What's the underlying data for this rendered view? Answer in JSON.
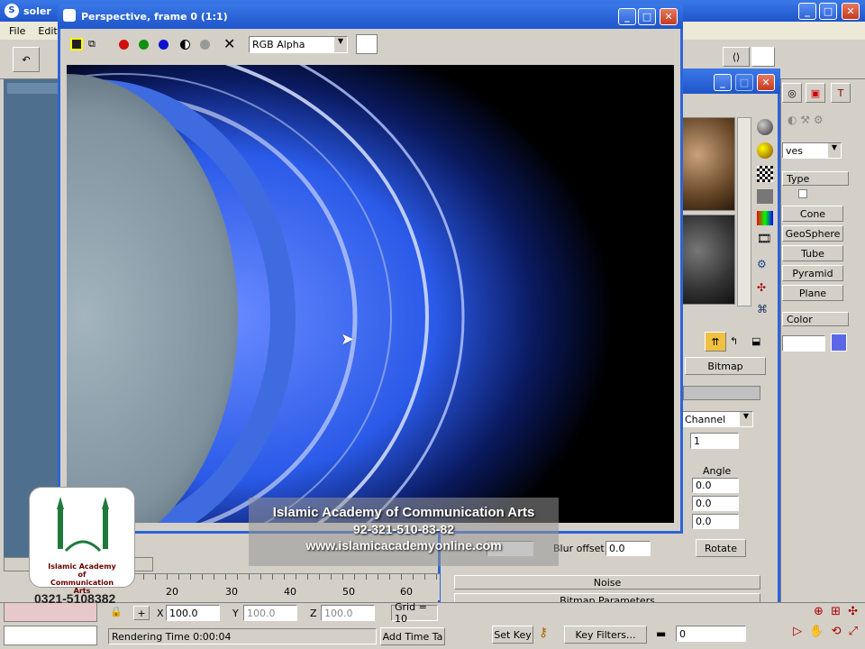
{
  "app": {
    "title": "soler",
    "menu": [
      "File",
      "Edit"
    ]
  },
  "render_window": {
    "title": "Perspective, frame 0 (1:1)",
    "channel_select": "RGB Alpha"
  },
  "mat_panel": {
    "buttons": [
      "Cone",
      "GeoSphere",
      "Tube",
      "Pyramid",
      "Plane"
    ],
    "color_label": "Color",
    "type_label": "Type",
    "dropdown": "ves"
  },
  "map_panel": {
    "bitmap_btn": "Bitmap",
    "channel": "Channel",
    "channel_value": "1",
    "angle_label": "Angle",
    "u": "0.0",
    "v": "0.0",
    "w": "0.0",
    "blur_offset_label": "Blur offset:",
    "blur_offset": "0.0",
    "rotate_btn": "Rotate",
    "noise": "Noise",
    "bitmap_params": "Bitmap Parameters"
  },
  "timeline": {
    "ticks": [
      "20",
      "30",
      "40",
      "50",
      "60"
    ]
  },
  "status": {
    "x_label": "X",
    "x": "100.0",
    "y_label": "Y",
    "y": "100.0",
    "z_label": "Z",
    "z": "100.0",
    "grid": "Grid = 10",
    "rendering": "Rendering Time  0:00:04",
    "add_time_tag": "Add Time Ta",
    "set_key": "Set Key",
    "key_filters": "Key Filters...",
    "frame": "0"
  },
  "watermark": {
    "line1": "Islamic Academy of Communication Arts",
    "line2": "92-321-510-83-82",
    "line3": "www.islamicacademyonline.com",
    "logo_text": "Islamic Academy of Communication Arts",
    "phone": "0321-5108382"
  }
}
